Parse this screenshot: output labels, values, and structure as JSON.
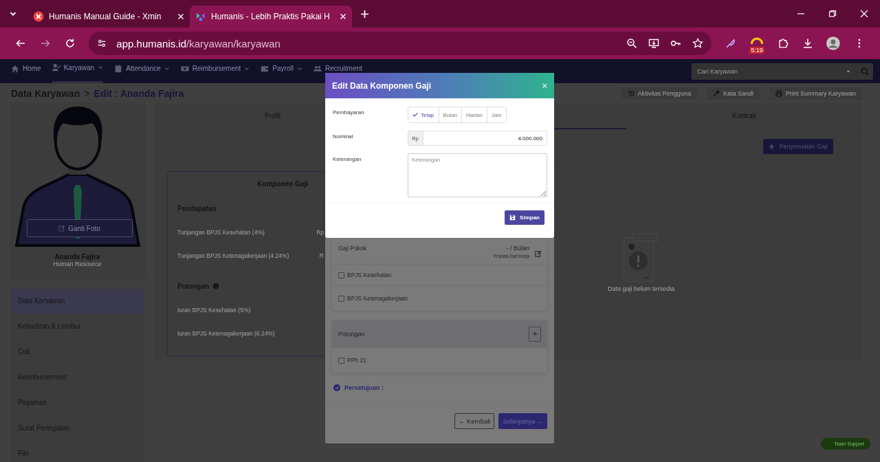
{
  "browser": {
    "tabs": [
      {
        "title": "Humanis Manual Guide - Xmin",
        "selected": false
      },
      {
        "title": "Humanis - Lebih Praktis Pakai H",
        "selected": true
      }
    ],
    "url_host": "app.humanis.id",
    "url_path": "/karyawan/karyawan",
    "extension_badge": "5:19"
  },
  "navbar": {
    "items": [
      {
        "label": "Home",
        "kind": "home",
        "dropdown": false,
        "selected": false
      },
      {
        "label": "Karyawan",
        "kind": "user",
        "dropdown": true,
        "selected": true
      },
      {
        "label": "Attendance",
        "kind": "calendar",
        "dropdown": true,
        "selected": false
      },
      {
        "label": "Reimbursement",
        "kind": "money",
        "dropdown": true,
        "selected": false
      },
      {
        "label": "Payroll",
        "kind": "wallet",
        "dropdown": true,
        "selected": false
      },
      {
        "label": "Recruitment",
        "kind": "users",
        "dropdown": false,
        "selected": false
      }
    ],
    "search": {
      "placeholder": "Cari Karyawan"
    }
  },
  "breadcrumb": {
    "parent": "Data Karyawan",
    "separator": ">",
    "current": "Edit : Ananda Fajira"
  },
  "actions": [
    {
      "label": "Aktivitas Pengguna",
      "kind": "history"
    },
    {
      "label": "Kata Sandi",
      "kind": "key"
    },
    {
      "label": "Print Summary Karyawan",
      "kind": "print"
    }
  ],
  "profile": {
    "photo_button": "Ganti Foto",
    "name": "Ananda Fajira",
    "role": "Human Resource"
  },
  "sidebar": {
    "items": [
      {
        "label": "Data Karyawan",
        "selected": true
      },
      {
        "label": "Kehadiran & Lembur",
        "selected": false
      },
      {
        "label": "Cuti",
        "selected": false
      },
      {
        "label": "Reimbursement",
        "selected": false
      },
      {
        "label": "Pinjaman",
        "selected": false
      },
      {
        "label": "Surat Peringatan",
        "selected": false
      },
      {
        "label": "File",
        "selected": false
      }
    ]
  },
  "main": {
    "tabs": [
      {
        "label": "Profil",
        "selected": false
      },
      {
        "selected": true
      },
      {
        "label": "Kontrak",
        "selected": false
      }
    ],
    "adjust_button": "Penyesuaian Gaji",
    "components": {
      "title": "Komponen Gaji",
      "sections": [
        {
          "title": "Pendapatan",
          "info": false,
          "rows": [
            {
              "label": "Tunjangan BPJS Kesehatan (4%)",
              "value": "Rp"
            },
            {
              "label": "Tunjangan BPJS Ketenagakerjaan (4.24%)",
              "value": "R"
            }
          ]
        },
        {
          "title": "Potongan",
          "info": true,
          "rows": [
            {
              "label": "Iuran BPJS Kesehatan (5%)"
            },
            {
              "label": "Iuran BPJS Ketenagakerjaan (6.24%)"
            }
          ]
        }
      ]
    },
    "empty_state": "Data gaji belum tersedia"
  },
  "back_modal": {
    "base_salary": {
      "label": "Gaji Pokok",
      "value": "- / Bulan",
      "note": "Prorata Hari Kerja"
    },
    "income_checks": [
      {
        "label": "BPJS Kesehatan",
        "checked": false
      },
      {
        "label": "BPJS Ketenagakerjaan",
        "checked": false
      }
    ],
    "deductions": {
      "title": "Potongan",
      "add": "+",
      "items": [
        {
          "label": "PPh 21",
          "checked": false
        }
      ]
    },
    "approval": "Persetujuan :",
    "back": "← Kembali",
    "next": "Selanjutnya →"
  },
  "modal": {
    "title": "Edit Data Komponen Gaji",
    "close": "×",
    "payment": {
      "label": "Pembayaran",
      "options": [
        {
          "label": "Tetap",
          "selected": true
        },
        {
          "label": "Bulan",
          "selected": false
        },
        {
          "label": "Harian",
          "selected": false
        },
        {
          "label": "Jam",
          "selected": false
        }
      ]
    },
    "nominal": {
      "label": "Nominal",
      "prefix": "Rp",
      "value": "4.000.000"
    },
    "note": {
      "label": "Keterangan",
      "placeholder": "Keterangan"
    },
    "save": "Simpan"
  },
  "support_button": "Team Support"
}
